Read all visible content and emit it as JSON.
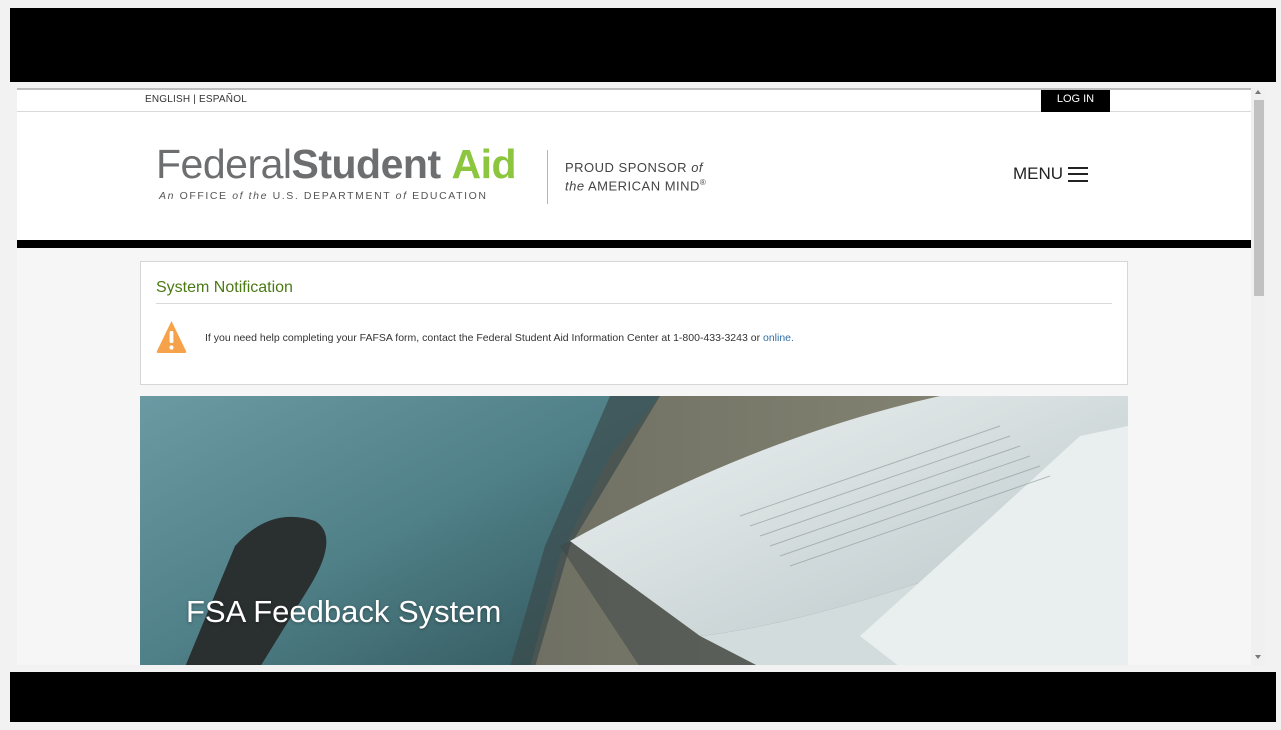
{
  "utility": {
    "language": "ENGLISH | ESPAÑOL",
    "login_label": "LOG IN"
  },
  "header": {
    "logo_federal": "Federal",
    "logo_student": "Student",
    "logo_aid": "Aid",
    "logo_sub_1": "An ",
    "logo_sub_2": "OFFICE ",
    "logo_sub_3": "of the",
    "logo_sub_4": " U.S. DEPARTMENT ",
    "logo_sub_5": "of",
    "logo_sub_6": " EDUCATION",
    "sponsor_1": "PROUD SPONSOR ",
    "sponsor_2": "of",
    "sponsor_3": "the",
    "sponsor_4": " AMERICAN MIND",
    "sponsor_5": "®",
    "menu_label": "MENU"
  },
  "notification": {
    "title": "System Notification",
    "message": "If you need help completing your FAFSA form, contact the Federal Student Aid Information Center at 1-800-433-3243 or ",
    "link_label": "online."
  },
  "hero": {
    "title": "FSA Feedback System"
  },
  "colors": {
    "brand_green": "#8cc63f",
    "notice_title_green": "#4b7a14",
    "warning_orange": "#f6a24a",
    "link_blue": "#2f6ea6"
  },
  "icons": [
    "warning-icon",
    "hamburger-menu-icon"
  ]
}
